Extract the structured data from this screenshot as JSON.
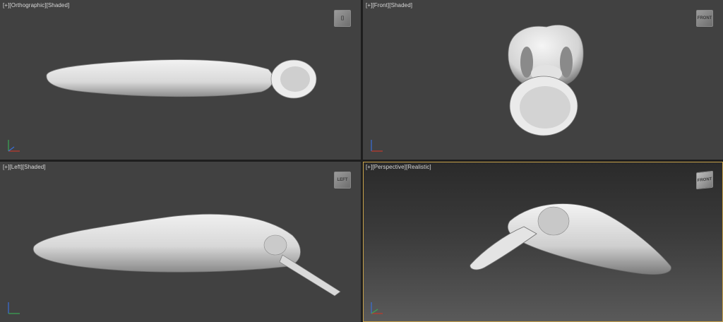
{
  "viewports": [
    {
      "id": "top-left",
      "label": [
        "[+]",
        "[Orthographic]",
        "[Shaded]"
      ],
      "cube": "[]"
    },
    {
      "id": "top-right",
      "label": [
        "[+]",
        "[Front]",
        "[Shaded]"
      ],
      "cube": "FRONT"
    },
    {
      "id": "bottom-left",
      "label": [
        "[+]",
        "[Left]",
        "[Shaded]"
      ],
      "cube": "LEFT"
    },
    {
      "id": "bottom-right",
      "label": [
        "[+]",
        "[Perspective]",
        "[Realistic]"
      ],
      "cube": "FRONT"
    }
  ],
  "colors": {
    "viewport_bg": "#414141",
    "active_border": "#c8a24a",
    "model": "#d6d6d6",
    "axis_x": "#c0392b",
    "axis_y": "#3aa655",
    "axis_z": "#3a6fd8"
  },
  "icons": [
    "viewcube-icon",
    "axis-tripod-icon"
  ]
}
